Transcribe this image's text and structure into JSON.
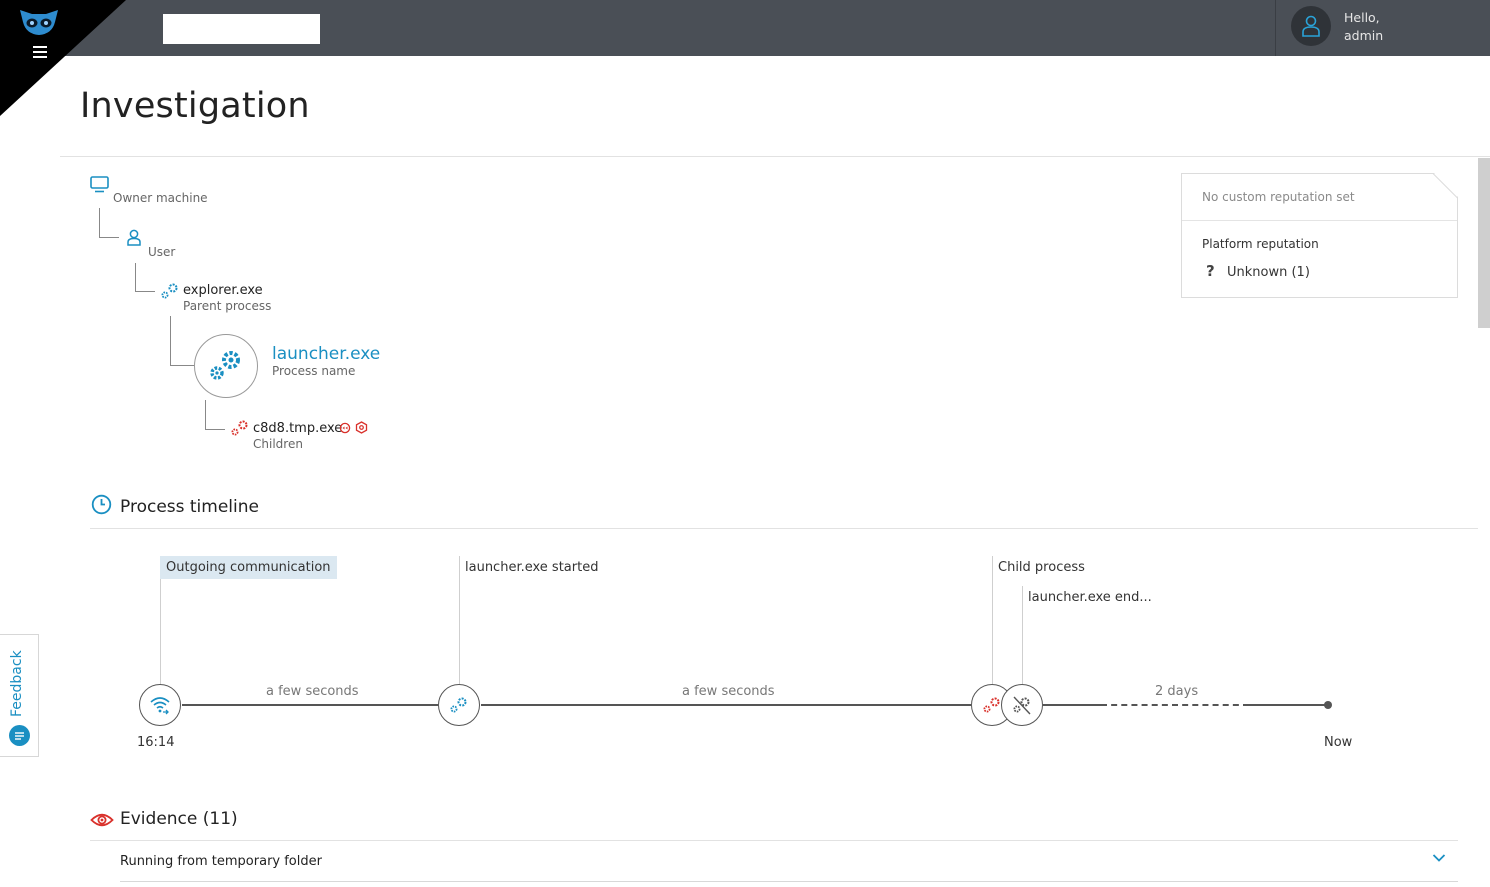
{
  "header": {
    "greeting_line1": "Hello,",
    "greeting_line2": "admin",
    "search_value": ""
  },
  "page": {
    "title": "Investigation"
  },
  "tree": {
    "owner_label": "Owner machine",
    "user_label": "User",
    "parent_name": "explorer.exe",
    "parent_label": "Parent process",
    "process_name": "launcher.exe",
    "process_label": "Process name",
    "child_name": "c8d8.tmp.exe",
    "child_label": "Children"
  },
  "reputation": {
    "custom": "No custom reputation set",
    "platform_title": "Platform reputation",
    "platform_value": "Unknown (1)"
  },
  "timeline": {
    "title": "Process timeline",
    "events": [
      {
        "label": "Outgoing communication"
      },
      {
        "label": "launcher.exe started"
      },
      {
        "label": "Child process"
      },
      {
        "label": "launcher.exe end..."
      }
    ],
    "gaps": [
      "a few seconds",
      "a few seconds",
      "2 days"
    ],
    "start_time": "16:14",
    "end_time": "Now"
  },
  "evidence": {
    "title": "Evidence (11)",
    "items": [
      {
        "label": "Running from temporary folder"
      }
    ]
  },
  "feedback": {
    "label": "Feedback"
  },
  "colors": {
    "accent": "#1a8fc2",
    "danger": "#d9312b",
    "topbar": "#4a4f56"
  }
}
